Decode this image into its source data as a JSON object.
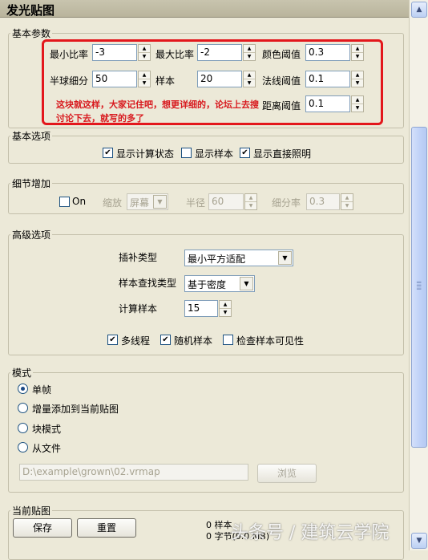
{
  "title": "发光贴图",
  "basic_params": {
    "legend": "基本参数",
    "min_rate_label": "最小比率",
    "min_rate": "-3",
    "max_rate_label": "最大比率",
    "max_rate": "-2",
    "color_thresh_label": "颜色阈值",
    "color_thresh": "0.3",
    "hsph_label": "半球细分",
    "hsph": "50",
    "samples_label": "样本",
    "samples": "20",
    "normal_thresh_label": "法线阈值",
    "normal_thresh": "0.1",
    "dist_thresh_label": "距离阈值",
    "dist_thresh": "0.1",
    "note_line1": "这块就这样，大家记住吧，想更详细的，论坛上去搜",
    "note_line2": "讨论下去，就写的多了"
  },
  "basic_options": {
    "legend": "基本选项",
    "show_calc_label": "显示计算状态",
    "show_calc": true,
    "show_samples_label": "显示样本",
    "show_samples": false,
    "show_direct_label": "显示直接照明",
    "show_direct": true
  },
  "detail": {
    "legend": "细节增加",
    "on_label": "On",
    "scale_label": "缩放",
    "scale_value": "屏幕",
    "radius_label": "半径",
    "radius_value": "60",
    "subdiv_label": "细分率",
    "subdiv_value": "0.3"
  },
  "advanced": {
    "legend": "高级选项",
    "interp_label": "插补类型",
    "interp_value": "最小平方适配",
    "lookup_label": "样本查找类型",
    "lookup_value": "基于密度",
    "calc_samples_label": "计算样本",
    "calc_samples": "15",
    "multithread_label": "多线程",
    "multithread": true,
    "random_label": "随机样本",
    "random": true,
    "check_vis_label": "检查样本可见性",
    "check_vis": false
  },
  "mode": {
    "legend": "模式",
    "options": [
      "单帧",
      "增量添加到当前贴图",
      "块模式",
      "从文件"
    ],
    "selected_index": 0,
    "file_path": "D:\\example\\grown\\02.vrmap",
    "browse_label": "浏览"
  },
  "current_map": {
    "legend": "当前贴图",
    "save_label": "保存",
    "reset_label": "重置",
    "samples_text": "0 样本",
    "bytes_text": "0 字节(0.0 MB)"
  },
  "watermark": "头条号 / 建筑云学院"
}
